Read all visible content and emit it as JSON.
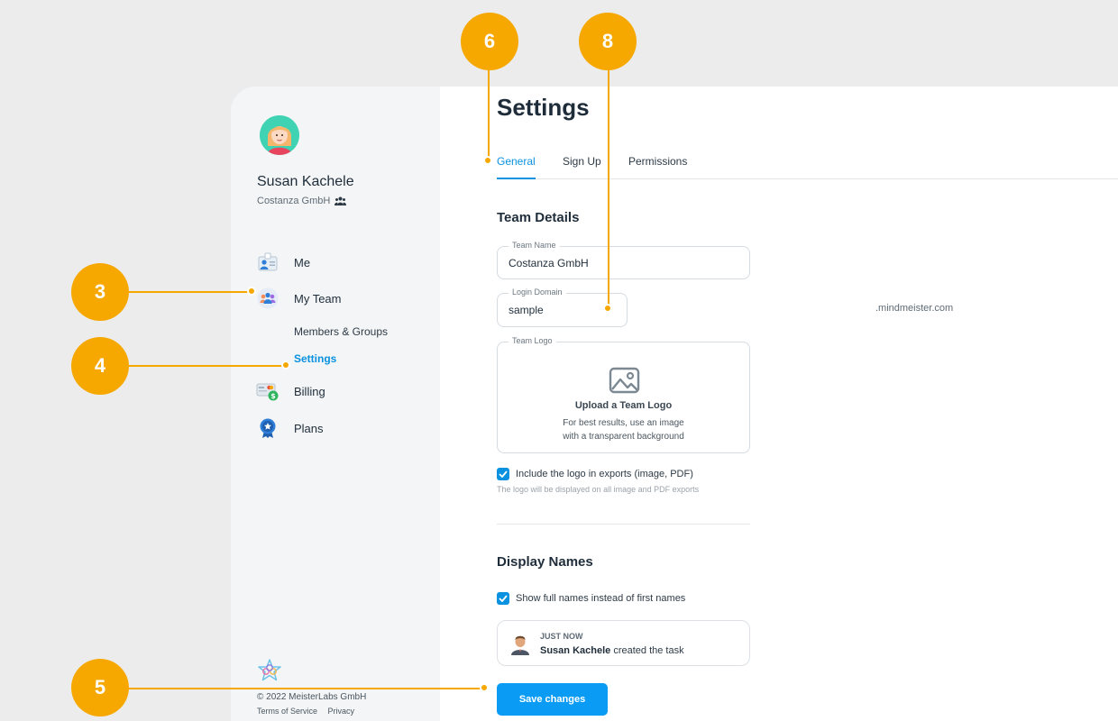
{
  "user": {
    "name": "Susan Kachele",
    "team": "Costanza GmbH"
  },
  "sidebar": {
    "items": [
      {
        "label": "Me"
      },
      {
        "label": "My Team"
      },
      {
        "label": "Billing"
      },
      {
        "label": "Plans"
      }
    ],
    "subitems": [
      {
        "label": "Members & Groups"
      },
      {
        "label": "Settings"
      }
    ],
    "copyright": "© 2022 MeisterLabs GmbH",
    "links": [
      "Terms of Service",
      "Privacy"
    ]
  },
  "page": {
    "title": "Settings",
    "tabs": [
      "General",
      "Sign Up",
      "Permissions"
    ]
  },
  "team_details": {
    "title": "Team Details",
    "team_name_label": "Team Name",
    "team_name_value": "Costanza GmbH",
    "login_domain_label": "Login Domain",
    "login_domain_value": "sample",
    "domain_suffix": ".mindmeister.com",
    "team_logo_label": "Team Logo",
    "upload_title": "Upload a Team Logo",
    "upload_hint_1": "For best results, use an image",
    "upload_hint_2": "with a transparent background",
    "include_logo_label": "Include the logo in exports (image, PDF)",
    "include_logo_hint": "The logo will be displayed on all image and PDF exports",
    "include_logo_checked": true
  },
  "display_names": {
    "title": "Display Names",
    "full_names_label": "Show full names instead of first names",
    "full_names_checked": true,
    "preview_time": "JUST NOW",
    "preview_name": "Susan Kachele",
    "preview_action": "created the task"
  },
  "actions": {
    "save_label": "Save changes"
  },
  "callouts": [
    "3",
    "4",
    "5",
    "6",
    "8"
  ],
  "colors": {
    "accent": "#0a91e0",
    "callout": "#f6a800",
    "button": "#0a9cf5"
  }
}
